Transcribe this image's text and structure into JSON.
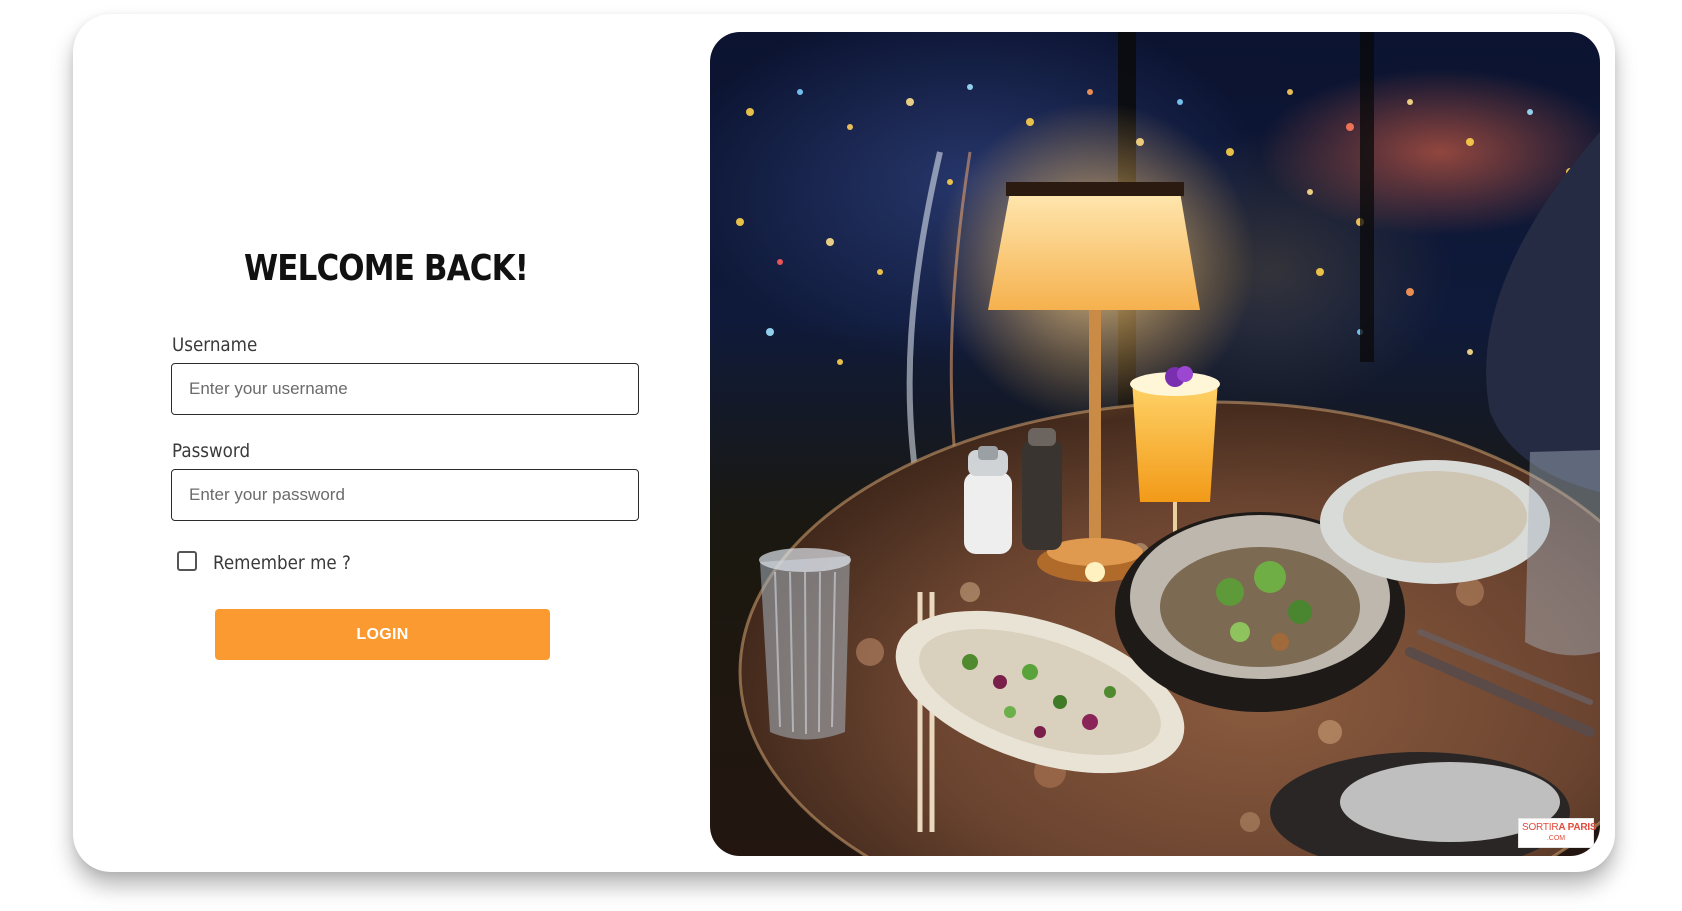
{
  "login": {
    "title": "WELCOME BACK!",
    "username_label": "Username",
    "username_placeholder": "Enter your username",
    "username_value": "",
    "password_label": "Password",
    "password_placeholder": "Enter your password",
    "password_value": "",
    "remember_label": "Remember me ?",
    "remember_checked": false,
    "login_button_label": "LOGIN"
  },
  "photo": {
    "description_icon": "restaurant-photo",
    "watermark_prefix": "SORTIR",
    "watermark_brand": "A PARIS",
    "watermark_sub": ".COM"
  },
  "colors": {
    "accent": "#fb9a31",
    "text": "#111111",
    "label": "#3a3a3a",
    "border": "#2b2b2b",
    "watermark": "#e24b3b"
  }
}
